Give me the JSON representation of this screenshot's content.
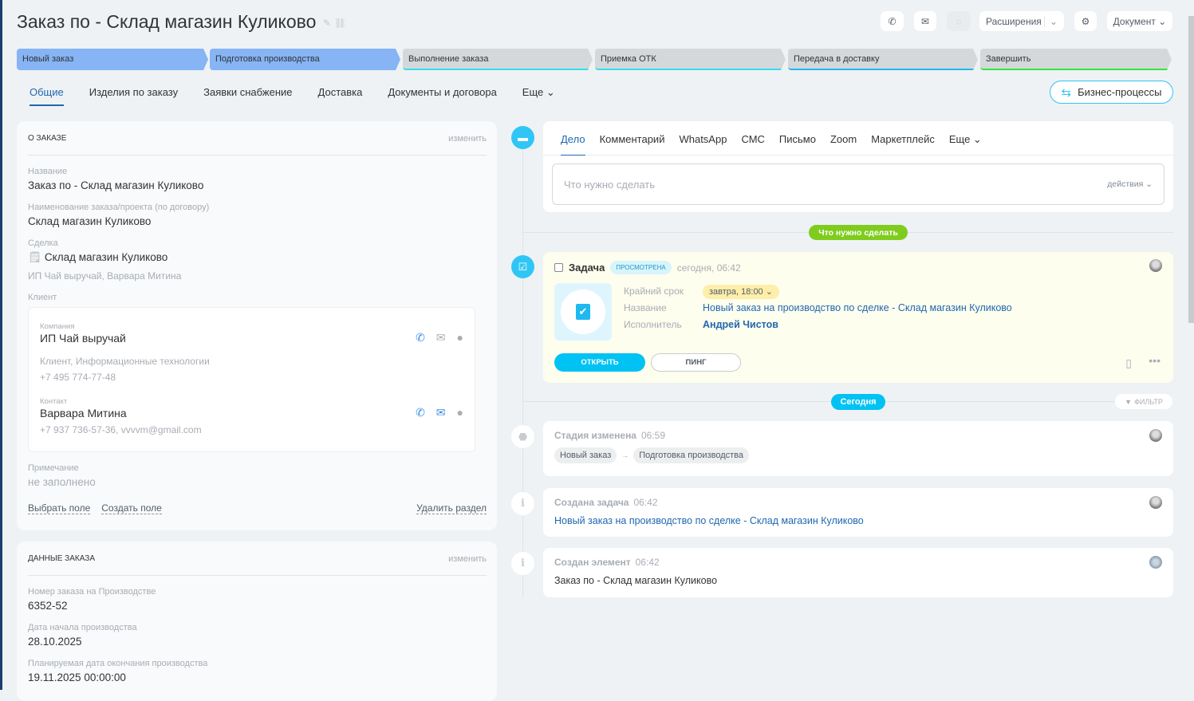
{
  "header": {
    "title": "Заказ по - Склад магазин Куликово",
    "extensions": "Расширения",
    "document": "Документ"
  },
  "stages": [
    {
      "label": "Новый заказ",
      "color": "#86b4f5",
      "line": "#86b4f5"
    },
    {
      "label": "Подготовка производства",
      "color": "#86b4f5",
      "line": "#86b4f5"
    },
    {
      "label": "Выполнение заказа",
      "color": "#d5d8db",
      "line": "#2fe0ef"
    },
    {
      "label": "Приемка ОТК",
      "color": "#d5d8db",
      "line": "#2fe0ef"
    },
    {
      "label": "Передача в доставку",
      "color": "#d5d8db",
      "line": "#1fb8f0"
    },
    {
      "label": "Завершить",
      "color": "#d5d8db",
      "line": "#2fe63f"
    }
  ],
  "tabs": [
    "Общие",
    "Изделия по заказу",
    "Заявки снабжение",
    "Доставка",
    "Документы и договора",
    "Еще"
  ],
  "business_processes": "Бизнес-процессы",
  "about": {
    "title": "О ЗАКАЗЕ",
    "edit": "изменить",
    "name_label": "Название",
    "name": "Заказ по - Склад магазин Куликово",
    "project_label": "Наименование заказа/проекта (по договору)",
    "project": "Склад магазин Куликово",
    "deal_label": "Сделка",
    "deal": "Склад магазин Куликово",
    "deal_sub": "ИП Чай выручай, Варвара Митина",
    "client_label": "Клиент",
    "company_label": "Компания",
    "company": "ИП Чай выручай",
    "company_info": "Клиент, Информационные технологии",
    "company_phone": "+7 495 774-77-48",
    "contact_label": "Контакт",
    "contact": "Варвара Митина",
    "contact_info": "+7 937 736-57-36, vvvvm@gmail.com",
    "note_label": "Примечание",
    "note": "не заполнено",
    "select_field": "Выбрать поле",
    "create_field": "Создать поле",
    "delete_section": "Удалить раздел"
  },
  "order_data": {
    "title": "ДАННЫЕ ЗАКАЗА",
    "edit": "изменить",
    "fields": [
      {
        "label": "Номер заказа на Производстве",
        "value": "6352-52"
      },
      {
        "label": "Дата начала производства",
        "value": "28.10.2025"
      },
      {
        "label": "Планируемая дата окончания производства",
        "value": "19.11.2025 00:00:00"
      }
    ]
  },
  "composer": {
    "tabs": [
      "Дело",
      "Комментарий",
      "WhatsApp",
      "СМС",
      "Письмо",
      "Zoom",
      "Маркетплейс",
      "Еще"
    ],
    "placeholder": "Что нужно сделать",
    "actions": "действия"
  },
  "todo_pill": "Что нужно сделать",
  "task": {
    "title": "Задача",
    "badge": "ПРОСМОТРЕНА",
    "time": "сегодня, 06:42",
    "deadline_label": "Крайний срок",
    "deadline": "завтра, 18:00",
    "name_label": "Название",
    "name": "Новый заказ на производство по сделке - Склад магазин Куликово",
    "assignee_label": "Исполнитель",
    "assignee": "Андрей Чистов",
    "open": "ОТКРЫТЬ",
    "ping": "ПИНГ"
  },
  "today": "Сегодня",
  "filter": "ФИЛЬТР",
  "events": [
    {
      "title": "Стадия изменена",
      "time": "06:59",
      "from": "Новый заказ",
      "to": "Подготовка производства"
    },
    {
      "title": "Создана задача",
      "time": "06:42",
      "text": "Новый заказ на производство по сделке - Склад магазин Куликово"
    },
    {
      "title": "Создан элемент",
      "time": "06:42",
      "text": "Заказ по - Склад магазин Куликово"
    }
  ]
}
